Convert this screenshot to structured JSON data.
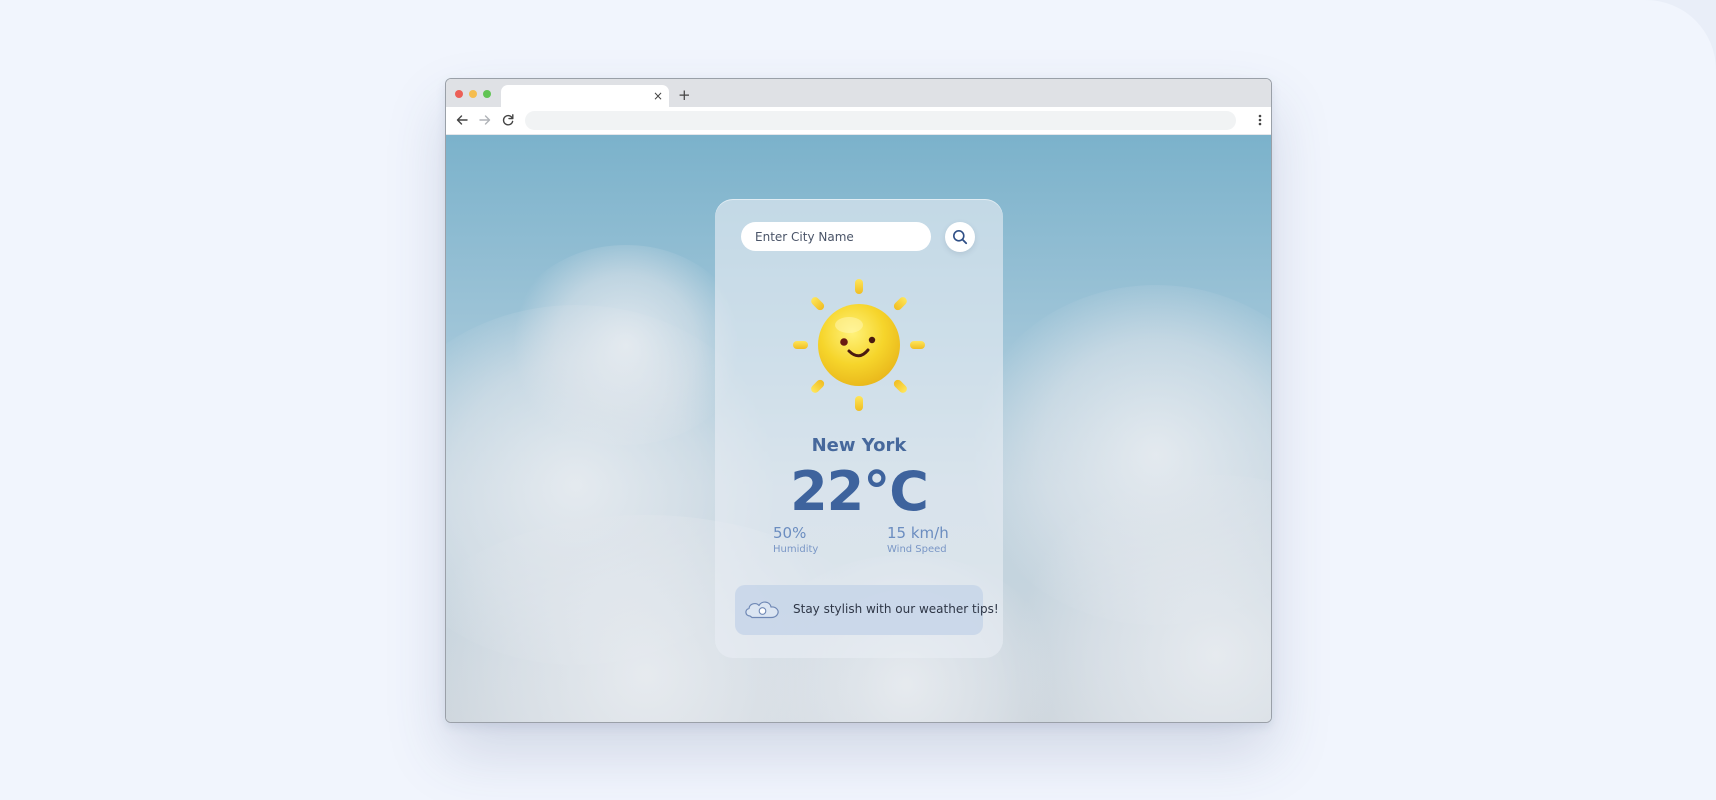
{
  "browser": {
    "tab_close_glyph": "×",
    "new_tab_glyph": "+",
    "address": ""
  },
  "weather_app": {
    "search": {
      "placeholder": "Enter City Name",
      "value": ""
    },
    "city": "New York",
    "temperature": "22°C",
    "humidity": {
      "value": "50%",
      "label": "Humidity"
    },
    "wind": {
      "value": "15 km/h",
      "label": "Wind Speed"
    },
    "tip": "Stay stylish with our weather tips!"
  },
  "colors": {
    "accent": "#3e639d",
    "stat": "#6b8dc0",
    "sun": "#f5d42a"
  },
  "icons": {
    "search": "search-icon",
    "weather": "sun-icon",
    "tip": "cloud-icon",
    "back": "back-arrow-icon",
    "forward": "forward-arrow-icon",
    "reload": "reload-icon",
    "menu": "more-vertical-icon"
  }
}
